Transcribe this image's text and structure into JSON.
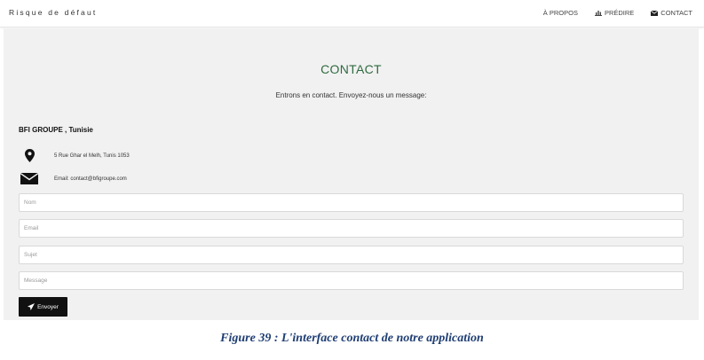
{
  "navbar": {
    "brand": "Risque de défaut",
    "links": [
      {
        "label": "À PROPOS",
        "icon": ""
      },
      {
        "label": "PRÉDIRE",
        "icon": "bar-chart-icon"
      },
      {
        "label": "CONTACT",
        "icon": "envelope-icon"
      }
    ]
  },
  "contact": {
    "title": "CONTACT",
    "subtitle": "Entrons en contact. Envoyez-nous un message:",
    "company": "BFI GROUPE , Tunisie",
    "address": {
      "icon": "map-marker-icon",
      "text": "5 Rue Ghar el Melh, Tunis 1053"
    },
    "email": {
      "icon": "envelope-icon",
      "text": "Email: contact@bfigroupe.com"
    }
  },
  "form": {
    "nom_placeholder": "Nom",
    "email_placeholder": "Email",
    "sujet_placeholder": "Sujet",
    "message_placeholder": "Message",
    "submit_label": "Envoyer",
    "submit_icon": "paper-plane-icon"
  },
  "caption": "Figure 39 : L'interface contact de notre application",
  "colors": {
    "title_green": "#2e6b3f",
    "panel_bg": "#f1f1f1",
    "button_bg": "#111111",
    "caption_blue": "#1f3e73"
  }
}
